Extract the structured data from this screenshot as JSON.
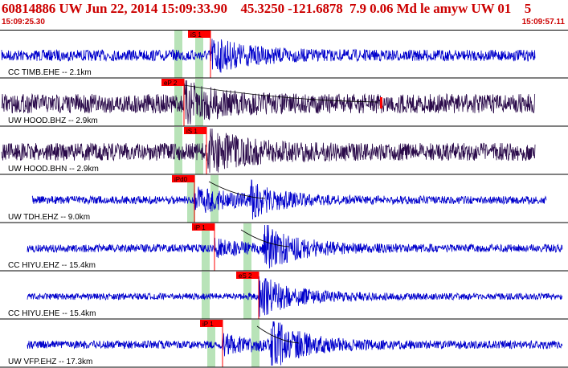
{
  "header": {
    "title": "60814886 UW Jun 22, 2014 15:09:33.90    45.3250 -121.6878  7.9 0.06 Md le amyw UW 01    5",
    "time_start": "15:09:25.30",
    "time_end": "15:09:57.11"
  },
  "colors": {
    "background": "#ffffff",
    "header_text": "#cc0000",
    "trace_blue": "#0000cc",
    "trace_dark": "#2a0a4a",
    "pick_red": "#ff0000",
    "window_green": "#b8e3b8",
    "divider": "#000000"
  },
  "channels": [
    {
      "label": "CC TIMB.EHE -- 2.1km",
      "pick": "iS 1",
      "color": "#0000cc"
    },
    {
      "label": "UW HOOD.BHZ -- 2.9km",
      "pick": "eP 2",
      "color": "#2a0a4a"
    },
    {
      "label": "UW HOOD.BHN -- 2.9km",
      "pick": "iS 1",
      "color": "#2a0a4a"
    },
    {
      "label": "UW TDH.EHZ -- 9.0km",
      "pick": "iPd0",
      "color": "#0000cc"
    },
    {
      "label": "CC HIYU.EHZ -- 15.4km",
      "pick": "iP 1",
      "color": "#0000cc"
    },
    {
      "label": "CC HIYU.EHE -- 15.4km",
      "pick": "eS 2",
      "color": "#0000cc"
    },
    {
      "label": "UW VFP.EHZ -- 17.3km",
      "pick": "iP 1",
      "color": "#0000cc"
    }
  ]
}
